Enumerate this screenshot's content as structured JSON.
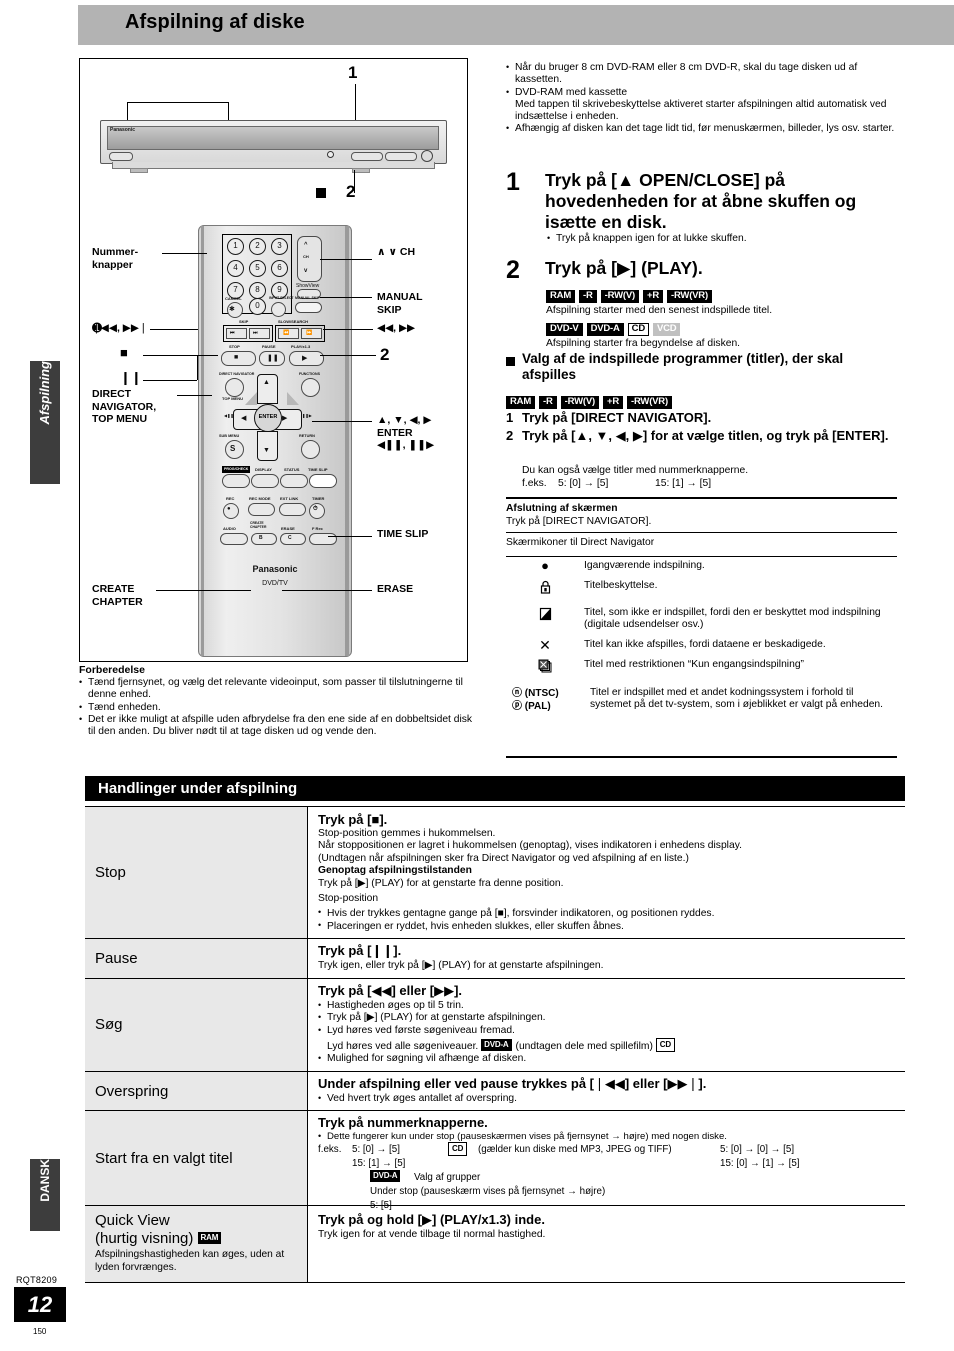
{
  "header": {
    "title": "Afspilning af diske"
  },
  "side": {
    "tab_chapter": "Afspilning",
    "tab_language": "DANSK",
    "doc_code": "RQT8209",
    "page_big": "12",
    "page_small": "150"
  },
  "figure": {
    "callout_1": "1",
    "callout_2a": "2",
    "callout_2b": "2",
    "labels": {
      "number_buttons": "Nummer-\nknapper",
      "ch": "∧ ∨ CH",
      "manual_skip": "MANUAL\nSKIP",
      "skip": "❘◀◀, ▶▶❘",
      "search": "◀◀, ▶▶",
      "stop": "■",
      "pause": "❙❙",
      "direct_navigator": "DIRECT\nNAVIGATOR,\nTOP MENU",
      "cursor": "▲, ▼, ◀, ▶",
      "enter": "ENTER",
      "slow": "◀❙❙, ❙❙▶",
      "time_slip": "TIME SLIP",
      "create_chapter": "CREATE\nCHAPTER",
      "erase": "ERASE"
    },
    "remote": {
      "brand": "Panasonic",
      "sub": "DVD/TV",
      "numbers": [
        "1",
        "2",
        "3",
        "4",
        "5",
        "6",
        "7",
        "8",
        "9",
        "0"
      ],
      "cancel": "CANCEL",
      "cancel_glyph": "✲",
      "input_select": "INPUT SELECT",
      "manual_skip": "MANUAL SKIP",
      "showview": "ShowView",
      "ch": "CH",
      "skip_group": "SKIP",
      "slow_search_group": "SLOW/SEARCH",
      "stop": "STOP",
      "pause": "PAUSE",
      "play": "PLAY/x1.3",
      "direct_nav": "DIRECT NAVIGATOR",
      "top_menu": "TOP MENU",
      "functions": "FUNCTIONS",
      "enter": "ENTER",
      "sub_menu": "SUB MENU",
      "sub_menu_glyph": "S",
      "return": "RETURN",
      "prog_check": "PROG/CHECK",
      "display": "DISPLAY",
      "status": "STATUS",
      "time_slip": "TIME SLIP",
      "rec": "REC",
      "rec_mode": "REC MODE",
      "ext_link": "EXT LINK",
      "timer": "TIMER",
      "audio": "AUDIO",
      "create_chapter": "CREATE\nCHAPTER",
      "erase": "ERASE",
      "f_rec": "F Rec",
      "btn_b": "B",
      "btn_c": "C"
    },
    "device": {
      "brand": "Panasonic",
      "open_close": "▲ OPEN/CLOSE"
    }
  },
  "intro_notes": [
    "Når du bruger 8 cm DVD-RAM eller 8 cm DVD-R, skal du tage disken ud af kassetten.",
    "DVD-RAM med kassette\nMed tappen til skrivebeskyttelse aktiveret starter afspilningen altid automatisk ved indsættelse i enheden.",
    "Afhængig af disken kan det tage lidt tid, før menuskærmen, billeder, lys osv. starter."
  ],
  "step1": {
    "num": "1",
    "head": "Tryk på [▲ OPEN/CLOSE] på hovedenheden for at åbne skuffen og isætte en disk.",
    "note": "Tryk på knappen igen for at lukke skuffen."
  },
  "step2": {
    "num": "2",
    "head": "Tryk på [▶] (PLAY).",
    "tags_a": [
      "RAM",
      "-R",
      "-RW(V)",
      "+R",
      "-RW(VR)"
    ],
    "text_a": "Afspilning starter med den senest indspillede titel.",
    "tags_b": [
      "DVD-V",
      "DVD-A",
      "CD",
      "VCD"
    ],
    "text_b": "Afspilning starter fra begyndelse af disken."
  },
  "select_section": {
    "heading": "Valg af de indspillede programmer (titler), der skal afspilles",
    "tags": [
      "RAM",
      "-R",
      "-RW(V)",
      "+R",
      "-RW(VR)"
    ],
    "items": [
      {
        "n": "1",
        "text": "Tryk på [DIRECT NAVIGATOR]."
      },
      {
        "n": "2",
        "text": "Tryk på [▲, ▼, ◀, ▶] for at vælge titlen, og tryk på [ENTER]."
      }
    ],
    "note": "Du kan også vælge titler med nummerknapperne.",
    "example_label": "f.eks.",
    "example_1": "5:  [0] → [5]",
    "example_2": "15:  [1] → [5]"
  },
  "exit_section": {
    "heading": "Afslutning af skærmen",
    "text": "Tryk på [DIRECT NAVIGATOR]."
  },
  "icons_section": {
    "heading": "Skærmikoner til Direct Navigator",
    "rows": [
      {
        "icon": "record-dot-icon",
        "glyph": "●",
        "text": "Igangværende indspilning."
      },
      {
        "icon": "lock-icon",
        "glyph": "🔒",
        "text": "Titelbeskyttelse."
      },
      {
        "icon": "no-record-icon",
        "glyph": "◧",
        "text": "Titel, som ikke er indspillet, fordi den er beskyttet mod indspilning (digitale udsendelser osv.)"
      },
      {
        "icon": "x-cross-icon",
        "glyph": "✕",
        "text": "Titel kan ikke afspilles, fordi dataene er beskadigede."
      },
      {
        "icon": "copy-once-icon",
        "glyph": "❐",
        "text": "Titel med restriktionen “Kun engangsindspilning”"
      },
      {
        "icon": "ntsc-pal-icon",
        "glyph": "ⓝ (NTSC)\nⓟ (PAL)",
        "text": "Titel er indspillet med et andet kodningssystem i forhold til systemet på det tv-system, som i øjeblikket er valgt på enheden."
      }
    ]
  },
  "preparation": {
    "heading": "Forberedelse",
    "items": [
      "Tænd fjernsynet, og vælg det relevante videoinput, som passer til tilslutningerne til denne enhed.",
      "Tænd enheden.",
      "Det er ikke muligt at afspille uden afbrydelse fra den ene side af en dobbeltsidet disk til den anden. Du bliver nødt til at tage disken ud og vende den."
    ]
  },
  "operations": {
    "section_title": "Handlinger under afspilning",
    "rows": [
      {
        "label": "Stop",
        "head": "Tryk på [■].",
        "lines": [
          "Stop-position gemmes i hukommelsen.",
          "Når stoppositionen er lagret i hukommelsen (genoptag), vises indikatoren i enhedens display. (Undtagen når afspilningen sker fra Direct Navigator og ved afspilning af en liste.)"
        ],
        "bold_line": "Genoptag afspilningstilstanden",
        "after_bold": "Tryk på [▶] (PLAY) for at genstarte fra denne position.",
        "caption": "Stop-position",
        "bullets": [
          "Hvis der trykkes gentagne gange på [■], forsvinder indikatoren, og positionen ryddes.",
          "Placeringen er ryddet, hvis enheden slukkes, eller skuffen åbnes."
        ]
      },
      {
        "label": "Pause",
        "head": "Tryk på [❙❙].",
        "lines": [
          "Tryk igen, eller tryk på [▶] (PLAY) for at genstarte afspilningen."
        ],
        "bullets": []
      },
      {
        "label": "Søg",
        "head": "Tryk på [◀◀] eller [▶▶].",
        "lines": [],
        "bullets": [
          "Hastigheden øges op til 5 trin.",
          "Tryk på [▶] (PLAY) for at genstarte afspilningen.",
          "Lyd høres ved første søgeniveau fremad.",
          "Mulighed for søgning vil afhænge af disken."
        ],
        "extra_line": "Lyd høres ved alle søgeniveauer.",
        "extra_tag": "DVD-A",
        "extra_line2": "(undtagen dele med spillefilm)",
        "extra_tag2": "CD"
      },
      {
        "label": "Overspring",
        "head": "Under afspilning eller ved pause trykkes på [❘◀◀] eller [▶▶❘].",
        "lines": [],
        "bullets": [
          "Ved hvert tryk øges antallet af overspring."
        ]
      },
      {
        "label": "Start fra en valgt titel",
        "head": "Tryk på nummerknapperne.",
        "bullets": [
          "Dette fungerer kun under stop (pauseskærmen vises på fjernsynet → højre) med nogen diske."
        ],
        "ex_label": "f.eks.",
        "ex_col1_l1": "5:   [0] → [5]",
        "ex_col1_l2": "15:  [1] → [5]",
        "ex_cd_tag": "CD",
        "ex_cd_text": "(gælder kun diske med MP3, JPEG og TIFF)",
        "ex_col2_l1": "5:   [0] → [0] → [5]",
        "ex_col2_l2": "15:  [0] → [1] → [5]",
        "dvda_tag": "DVD-A",
        "dvda_text": "Valg af grupper",
        "dvda_line2": "Under stop (pauseskærm vises på fjernsynet → højre)",
        "dvda_line3": "5:   [5]"
      },
      {
        "label": "Quick View",
        "label2": "(hurtig visning)",
        "label_tag": "RAM",
        "sublabel": "Afspilningshastigheden kan øges, uden at lyden forvrænges.",
        "head": "Tryk på og hold [▶] (PLAY/x1.3) inde.",
        "lines": [
          "Tryk igen for at vende tilbage til normal hastighed."
        ],
        "bullets": []
      }
    ]
  }
}
